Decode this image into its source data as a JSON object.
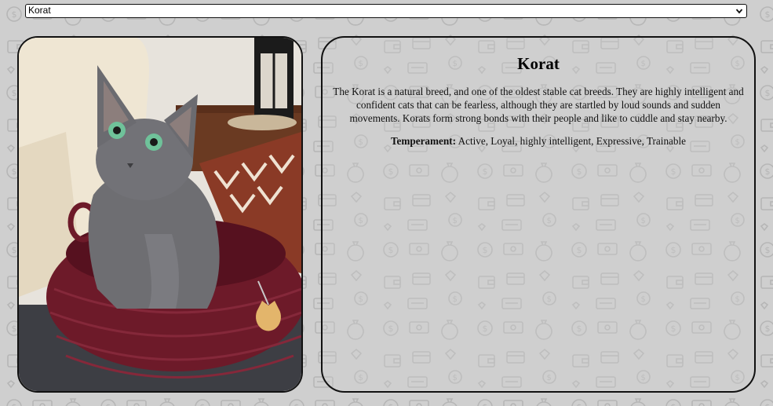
{
  "breed_select": {
    "selected": "Korat"
  },
  "breed_image": {
    "alt": "Korat"
  },
  "breed_info": {
    "name": "Korat",
    "description": "The Korat is a natural breed, and one of the oldest stable cat breeds. They are highly intelligent and confident cats that can be fearless, although they are startled by loud sounds and sudden movements. Korats form strong bonds with their people and like to cuddle and stay nearby.",
    "temperament_label": "Temperament:",
    "temperament": "Active, Loyal, highly intelligent, Expressive, Trainable"
  },
  "icons": {
    "select_chevron": "chevron-down-icon",
    "background": "money-pattern-icons"
  },
  "colors": {
    "background": "#cfcfcf",
    "pattern": "#b8b8b8",
    "border": "#111111",
    "basket": "#7a1f2e",
    "cat": "#6e6e72"
  }
}
